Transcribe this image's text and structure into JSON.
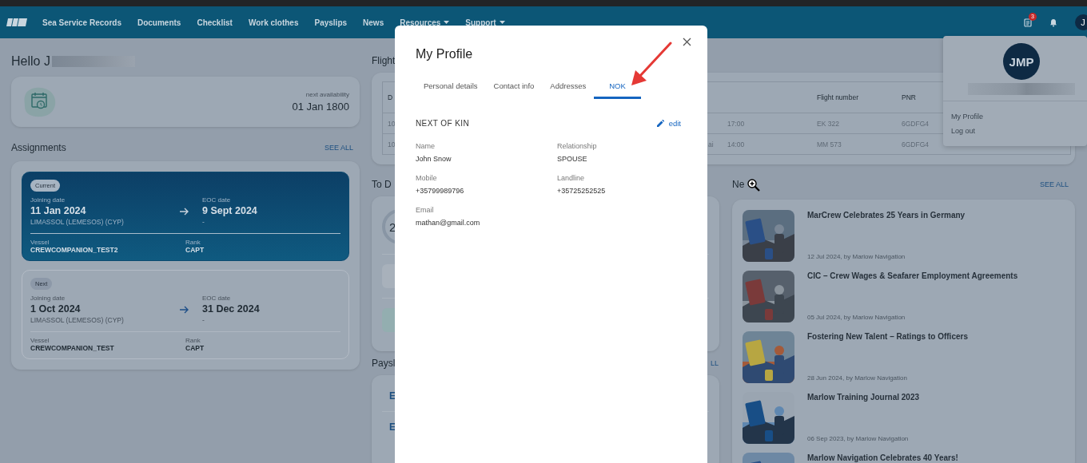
{
  "nav": {
    "items": [
      {
        "label": "Sea Service Records",
        "dropdown": false
      },
      {
        "label": "Documents",
        "dropdown": false
      },
      {
        "label": "Checklist",
        "dropdown": false
      },
      {
        "label": "Work clothes",
        "dropdown": false
      },
      {
        "label": "Payslips",
        "dropdown": false
      },
      {
        "label": "News",
        "dropdown": false
      },
      {
        "label": "Resources",
        "dropdown": true
      },
      {
        "label": "Support",
        "dropdown": true
      }
    ],
    "badge": "3",
    "avatar": "J"
  },
  "greeting": "Hello J",
  "availability": {
    "label": "next availability",
    "date": "01 Jan 1800"
  },
  "assignments": {
    "title": "Assignments",
    "see_all": "SEE ALL",
    "items": [
      {
        "status": "Current",
        "selected": true,
        "joining_label": "Joining date",
        "joining_date": "11 Jan 2024",
        "port": "LIMASSOL (LEMESOS) (CYP)",
        "eoc_label": "EOC date",
        "eoc_date": "9 Sept 2024",
        "eoc_port": "-",
        "vessel_label": "Vessel",
        "vessel": "CREWCOMPANION_TEST2",
        "rank_label": "Rank",
        "rank": "CAPT"
      },
      {
        "status": "Next",
        "selected": false,
        "joining_label": "Joining date",
        "joining_date": "1 Oct 2024",
        "port": "LIMASSOL (LEMESOS) (CYP)",
        "eoc_label": "EOC date",
        "eoc_date": "31 Dec 2024",
        "eoc_port": "-",
        "vessel_label": "Vessel",
        "vessel": "CREWCOMPANION_TEST",
        "rank_label": "Rank",
        "rank": "CAPT"
      }
    ]
  },
  "flights": {
    "title": "Flight",
    "header": {
      "column_1": "D",
      "flight_number": "Flight number",
      "pnr": "PNR"
    },
    "rows": [
      {
        "column_1": "10",
        "time": "17:00",
        "flight_number": "EK 322",
        "pnr": "6GDFG4"
      },
      {
        "column_1": "10",
        "column_2": "ai",
        "time": "14:00",
        "flight_number": "MM 573",
        "pnr": "6GDFG4"
      }
    ]
  },
  "todo": {
    "title": "To D",
    "count": "2"
  },
  "payslips": {
    "title": "Paysl",
    "see_all": "LL",
    "items": [
      "E",
      "E"
    ]
  },
  "news": {
    "title": "Ne",
    "see_all": "SEE ALL",
    "items": [
      {
        "title": "MarCrew Celebrates 25 Years in Germany",
        "meta": "12 Jul 2024, by Marlow Navigation",
        "kind": "picture"
      },
      {
        "title": "CIC – Crew Wages & Seafarer Employment Agreements",
        "meta": "05 Jul 2024, by Marlow Navigation",
        "kind": "picture"
      },
      {
        "title": "Fostering New Talent – Ratings to Officers",
        "meta": "28 Jun 2024, by Marlow Navigation",
        "kind": "picture"
      },
      {
        "title": "Marlow Training Journal 2023",
        "meta": "06 Sep 2023, by Marlow Navigation",
        "kind": "picture"
      },
      {
        "title": "Marlow Navigation Celebrates 40 Years!",
        "kind": "picture"
      }
    ]
  },
  "profile_menu": {
    "initials": "JMP",
    "items": [
      "My Profile",
      "Log out"
    ]
  },
  "modal": {
    "title": "My Profile",
    "tabs": [
      {
        "label": "Personal details",
        "selected": false
      },
      {
        "label": "Contact info",
        "selected": false
      },
      {
        "label": "Addresses",
        "selected": false
      },
      {
        "label": "NOK",
        "selected": true
      }
    ],
    "section": "NEXT OF KIN",
    "edit": "edit",
    "fields": [
      {
        "label": "Name",
        "value": "John Snow"
      },
      {
        "label": "Relationship",
        "value": "SPOUSE"
      },
      {
        "label": "Mobile",
        "value": "+35799989796"
      },
      {
        "label": "Landline",
        "value": "+35725252525"
      },
      {
        "label": "Email",
        "value": "mathan@gmail.com"
      }
    ]
  }
}
